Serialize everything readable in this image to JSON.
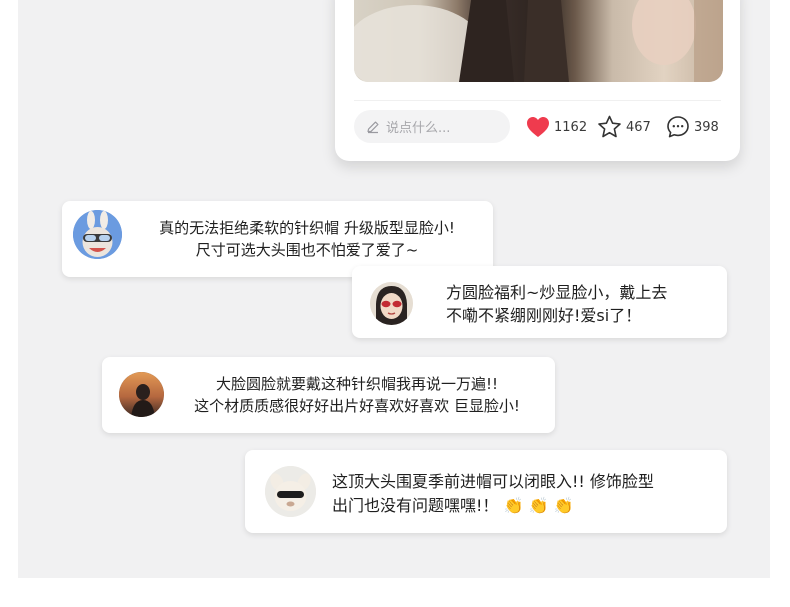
{
  "post": {
    "comment_placeholder": "说点什么...",
    "likes": "1162",
    "favorites": "467",
    "comments": "398",
    "like_color": "#ef3b4e",
    "icons": [
      "pencil-icon",
      "heart-icon",
      "star-icon",
      "comment-bubble-icon"
    ]
  },
  "comments": [
    {
      "line1": "真的无法拒绝柔软的针织帽 升级版型显脸小!",
      "line2": "尺寸可选大头围也不怕爱了爱了~"
    },
    {
      "line1": "方圆脸福利~炒显脸小，戴上去",
      "line2": "不嘞不紧绷刚刚好!爱si了！"
    },
    {
      "line1": "大脸圆脸就要戴这种针织帽我再说一万遍!!",
      "line2": "这个材质质感很好好出片好喜欢好喜欢 巨显脸小!"
    },
    {
      "line1": "这顶大头围夏季前进帽可以闭眼入!! 修饰脸型",
      "line2": "出门也没有问题嘿嘿!！",
      "emoji": "👏 👏 👏"
    }
  ]
}
